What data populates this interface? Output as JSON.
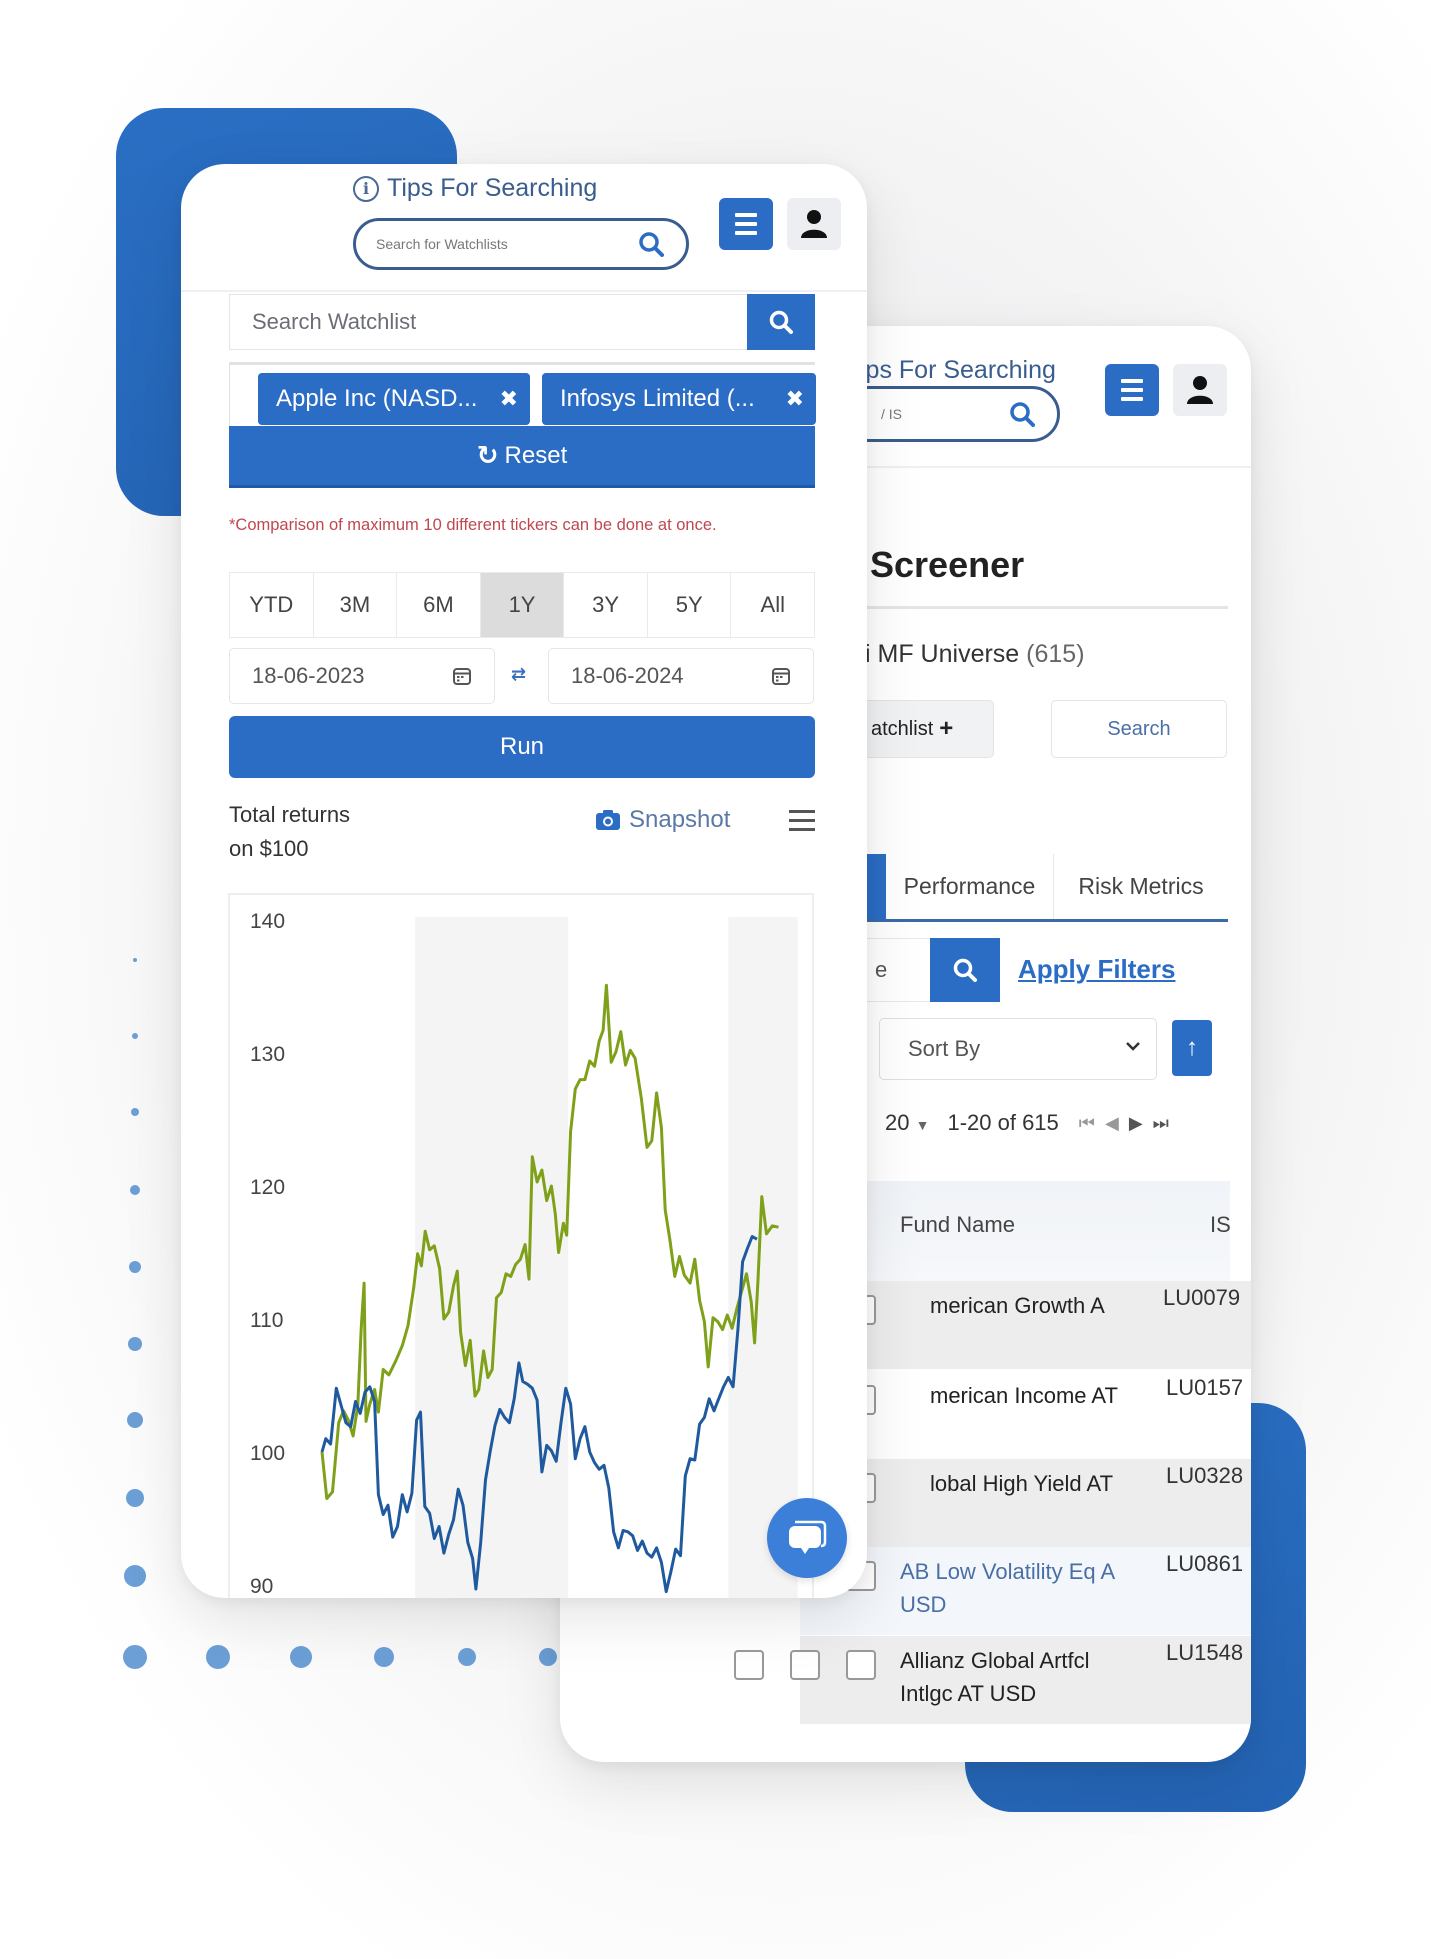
{
  "colors": {
    "brand_blue": "#2b6cc4",
    "apple_series": "#1f5a9e",
    "infosys_series": "#7fa11a",
    "note_red": "#c0474f"
  },
  "left_panel": {
    "header": {
      "tips_label": "Tips For Searching",
      "search_placeholder": "Search for Watchlists",
      "info_icon": "info-icon",
      "menu_icon": "hamburger-icon",
      "user_icon": "user-icon"
    },
    "watchlist_search": {
      "placeholder": "Search Watchlist",
      "icon": "search-icon"
    },
    "selected_tickers": [
      {
        "label": "Apple Inc (NASD...",
        "remove_icon": "close-icon"
      },
      {
        "label": "Infosys Limited (...",
        "remove_icon": "close-icon"
      }
    ],
    "reset_label": "Reset",
    "note": "*Comparison of maximum 10 different tickers can be done at once.",
    "periods": [
      {
        "label": "YTD",
        "active": false
      },
      {
        "label": "3M",
        "active": false
      },
      {
        "label": "6M",
        "active": false
      },
      {
        "label": "1Y",
        "active": true
      },
      {
        "label": "3Y",
        "active": false
      },
      {
        "label": "5Y",
        "active": false
      },
      {
        "label": "All",
        "active": false
      }
    ],
    "date_from": "18-06-2023",
    "date_to": "18-06-2024",
    "run_label": "Run",
    "chart_title_line1": "Total returns",
    "chart_title_line2": "on $100",
    "snapshot_label": "Snapshot"
  },
  "chart_data": {
    "type": "line",
    "title": "Total returns on $100",
    "xlabel": "",
    "ylabel": "",
    "ylim": [
      90,
      140
    ],
    "yticks": [
      140,
      130,
      120,
      110,
      100,
      90
    ],
    "grid": false,
    "shaded_bands_fraction": [
      [
        0.195,
        0.515
      ],
      [
        0.85,
        0.995
      ]
    ],
    "x": "trading days 18-06-2023 to 18-06-2024 (normalized 0-1)",
    "series": [
      {
        "name": "Infosys Limited",
        "color": "#7fa11a",
        "points": [
          [
            0.0,
            100.0
          ],
          [
            0.01,
            96.5
          ],
          [
            0.022,
            97.0
          ],
          [
            0.035,
            102.2
          ],
          [
            0.045,
            103.1
          ],
          [
            0.055,
            102.4
          ],
          [
            0.065,
            101.2
          ],
          [
            0.075,
            103.5
          ],
          [
            0.082,
            109.3
          ],
          [
            0.088,
            112.7
          ],
          [
            0.092,
            102.3
          ],
          [
            0.1,
            103.6
          ],
          [
            0.11,
            104.7
          ],
          [
            0.118,
            103.0
          ],
          [
            0.128,
            106.2
          ],
          [
            0.14,
            105.8
          ],
          [
            0.155,
            106.9
          ],
          [
            0.168,
            108.0
          ],
          [
            0.18,
            109.5
          ],
          [
            0.192,
            112.4
          ],
          [
            0.2,
            114.9
          ],
          [
            0.208,
            114.0
          ],
          [
            0.216,
            116.6
          ],
          [
            0.225,
            115.2
          ],
          [
            0.235,
            115.5
          ],
          [
            0.246,
            113.8
          ],
          [
            0.255,
            110.0
          ],
          [
            0.265,
            110.5
          ],
          [
            0.275,
            112.5
          ],
          [
            0.283,
            113.6
          ],
          [
            0.29,
            109.0
          ],
          [
            0.3,
            106.5
          ],
          [
            0.31,
            108.4
          ],
          [
            0.32,
            104.2
          ],
          [
            0.328,
            104.7
          ],
          [
            0.338,
            107.6
          ],
          [
            0.347,
            105.6
          ],
          [
            0.356,
            106.2
          ],
          [
            0.365,
            111.6
          ],
          [
            0.375,
            112.0
          ],
          [
            0.385,
            113.4
          ],
          [
            0.395,
            113.2
          ],
          [
            0.405,
            114.1
          ],
          [
            0.415,
            114.5
          ],
          [
            0.425,
            115.6
          ],
          [
            0.433,
            113.0
          ],
          [
            0.44,
            122.2
          ],
          [
            0.45,
            120.3
          ],
          [
            0.46,
            121.2
          ],
          [
            0.47,
            118.9
          ],
          [
            0.48,
            120.0
          ],
          [
            0.488,
            117.9
          ],
          [
            0.495,
            115.0
          ],
          [
            0.505,
            117.2
          ],
          [
            0.512,
            116.3
          ],
          [
            0.52,
            124.1
          ],
          [
            0.53,
            127.3
          ],
          [
            0.54,
            128.0
          ],
          [
            0.55,
            128.0
          ],
          [
            0.56,
            129.4
          ],
          [
            0.57,
            129.0
          ],
          [
            0.58,
            130.9
          ],
          [
            0.588,
            131.7
          ],
          [
            0.595,
            135.1
          ],
          [
            0.605,
            129.3
          ],
          [
            0.615,
            130.1
          ],
          [
            0.625,
            131.6
          ],
          [
            0.635,
            129.1
          ],
          [
            0.645,
            130.2
          ],
          [
            0.655,
            129.6
          ],
          [
            0.668,
            126.6
          ],
          [
            0.68,
            122.9
          ],
          [
            0.69,
            123.4
          ],
          [
            0.7,
            127.0
          ],
          [
            0.71,
            124.4
          ],
          [
            0.718,
            118.2
          ],
          [
            0.728,
            115.9
          ],
          [
            0.738,
            113.2
          ],
          [
            0.748,
            114.7
          ],
          [
            0.758,
            113.3
          ],
          [
            0.77,
            112.7
          ],
          [
            0.78,
            114.5
          ],
          [
            0.79,
            111.4
          ],
          [
            0.8,
            109.8
          ],
          [
            0.808,
            106.4
          ],
          [
            0.818,
            110.1
          ],
          [
            0.828,
            109.8
          ],
          [
            0.838,
            109.2
          ],
          [
            0.848,
            110.3
          ],
          [
            0.858,
            109.3
          ],
          [
            0.868,
            110.8
          ],
          [
            0.878,
            112.1
          ],
          [
            0.888,
            113.4
          ],
          [
            0.898,
            111.3
          ],
          [
            0.905,
            108.2
          ],
          [
            0.912,
            112.8
          ],
          [
            0.92,
            119.2
          ],
          [
            0.93,
            116.4
          ],
          [
            0.942,
            117.0
          ],
          [
            0.955,
            116.9
          ]
        ]
      },
      {
        "name": "Apple Inc",
        "color": "#1f5a9e",
        "points": [
          [
            0.0,
            100.0
          ],
          [
            0.008,
            101.0
          ],
          [
            0.018,
            100.6
          ],
          [
            0.03,
            104.8
          ],
          [
            0.04,
            103.5
          ],
          [
            0.05,
            102.2
          ],
          [
            0.06,
            101.9
          ],
          [
            0.07,
            103.8
          ],
          [
            0.08,
            102.9
          ],
          [
            0.09,
            104.5
          ],
          [
            0.1,
            104.9
          ],
          [
            0.11,
            103.8
          ],
          [
            0.118,
            96.8
          ],
          [
            0.128,
            95.3
          ],
          [
            0.138,
            96.0
          ],
          [
            0.148,
            93.6
          ],
          [
            0.158,
            94.4
          ],
          [
            0.168,
            96.8
          ],
          [
            0.178,
            95.5
          ],
          [
            0.188,
            96.9
          ],
          [
            0.198,
            102.4
          ],
          [
            0.206,
            103.0
          ],
          [
            0.215,
            95.9
          ],
          [
            0.225,
            95.4
          ],
          [
            0.235,
            93.5
          ],
          [
            0.245,
            94.4
          ],
          [
            0.255,
            92.4
          ],
          [
            0.265,
            93.8
          ],
          [
            0.275,
            94.9
          ],
          [
            0.285,
            97.2
          ],
          [
            0.295,
            96.0
          ],
          [
            0.305,
            93.2
          ],
          [
            0.315,
            92.0
          ],
          [
            0.322,
            89.7
          ],
          [
            0.332,
            93.2
          ],
          [
            0.342,
            97.9
          ],
          [
            0.352,
            100.1
          ],
          [
            0.362,
            102.0
          ],
          [
            0.372,
            103.2
          ],
          [
            0.382,
            102.6
          ],
          [
            0.392,
            102.2
          ],
          [
            0.402,
            104.0
          ],
          [
            0.412,
            106.7
          ],
          [
            0.42,
            105.3
          ],
          [
            0.43,
            105.1
          ],
          [
            0.44,
            104.8
          ],
          [
            0.45,
            103.9
          ],
          [
            0.46,
            98.5
          ],
          [
            0.47,
            100.5
          ],
          [
            0.48,
            100.1
          ],
          [
            0.49,
            99.3
          ],
          [
            0.5,
            102.2
          ],
          [
            0.51,
            104.8
          ],
          [
            0.52,
            103.6
          ],
          [
            0.53,
            99.5
          ],
          [
            0.54,
            101.0
          ],
          [
            0.55,
            101.9
          ],
          [
            0.56,
            100.0
          ],
          [
            0.57,
            99.2
          ],
          [
            0.58,
            98.7
          ],
          [
            0.59,
            99.0
          ],
          [
            0.6,
            97.3
          ],
          [
            0.61,
            94.0
          ],
          [
            0.62,
            92.8
          ],
          [
            0.63,
            94.1
          ],
          [
            0.64,
            94.0
          ],
          [
            0.65,
            93.7
          ],
          [
            0.66,
            92.6
          ],
          [
            0.67,
            93.3
          ],
          [
            0.68,
            92.4
          ],
          [
            0.69,
            92.1
          ],
          [
            0.7,
            92.8
          ],
          [
            0.71,
            91.7
          ],
          [
            0.72,
            89.5
          ],
          [
            0.73,
            91.0
          ],
          [
            0.74,
            92.7
          ],
          [
            0.75,
            92.2
          ],
          [
            0.76,
            98.2
          ],
          [
            0.77,
            99.5
          ],
          [
            0.78,
            99.4
          ],
          [
            0.79,
            102.1
          ],
          [
            0.8,
            102.6
          ],
          [
            0.81,
            104.0
          ],
          [
            0.82,
            103.1
          ],
          [
            0.83,
            104.0
          ],
          [
            0.84,
            104.9
          ],
          [
            0.85,
            105.6
          ],
          [
            0.86,
            104.9
          ],
          [
            0.87,
            109.2
          ],
          [
            0.88,
            114.3
          ],
          [
            0.89,
            115.3
          ],
          [
            0.9,
            116.2
          ],
          [
            0.91,
            116.0
          ]
        ]
      }
    ]
  },
  "right_panel": {
    "header": {
      "tips_label": "ips For Searching",
      "search_placeholder": "/ IS",
      "menu_icon": "hamburger-icon",
      "user_icon": "user-icon"
    },
    "title": "Screener",
    "universe_label": "MF Universe",
    "universe_prefix": "i",
    "universe_count": "(615)",
    "watchlist_button": "atchlist",
    "search_button": "Search",
    "tabs": [
      {
        "label": "",
        "active": true
      },
      {
        "label": "Performance",
        "active": false
      },
      {
        "label": "Risk Metrics",
        "active": false
      }
    ],
    "filter_input_value": "e",
    "apply_filters": "Apply Filters",
    "sort_by": "Sort By",
    "sort_direction_icon": "arrow-up-icon",
    "page_size": "20",
    "page_range": "1-20 of 615",
    "table": {
      "columns": [
        "Fund Name",
        "IS"
      ],
      "rows": [
        {
          "name": "American Growth A",
          "isin": "LU007 ",
          "link": false
        },
        {
          "name": "American Income AT",
          "isin": "LU0157",
          "link": false
        },
        {
          "name": "Global High Yield AT",
          "isin": "LU032 ",
          "link": false
        },
        {
          "name": "AB Low Volatility Eq A USD",
          "isin": "LU086 ",
          "link": true
        },
        {
          "name": "Allianz Global Artfcl Intlgc AT USD",
          "isin": "LU154 ",
          "link": false
        }
      ],
      "row_names_visible": [
        "merican Growth A",
        "merican Income AT",
        "lobal High Yield AT",
        "AB Low Volatility Eq A",
        "Allianz Global Artfcl"
      ],
      "row_names_line2": [
        "",
        "",
        "",
        "USD",
        "Intlgc AT USD"
      ],
      "isin_visible": [
        "LU0079",
        "LU0157",
        "LU0328",
        "LU0861",
        "LU1548"
      ]
    }
  }
}
